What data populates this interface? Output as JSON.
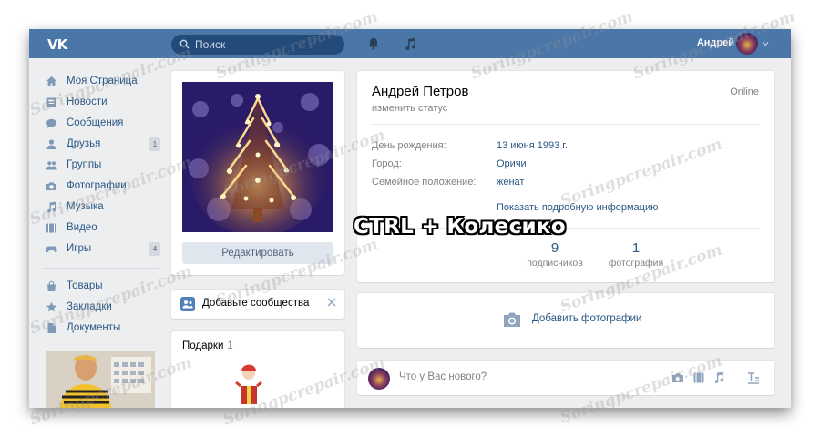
{
  "header": {
    "search_placeholder": "Поиск",
    "user_name": "Андрей",
    "logo_icon": "vk-logo-icon"
  },
  "sidebar": {
    "items": [
      {
        "label": "Моя Страница",
        "icon": "home-icon"
      },
      {
        "label": "Новости",
        "icon": "news-icon"
      },
      {
        "label": "Сообщения",
        "icon": "messages-icon"
      },
      {
        "label": "Друзья",
        "icon": "friends-icon",
        "badge": "1"
      },
      {
        "label": "Группы",
        "icon": "groups-icon"
      },
      {
        "label": "Фотографии",
        "icon": "camera-icon"
      },
      {
        "label": "Музыка",
        "icon": "music-icon"
      },
      {
        "label": "Видео",
        "icon": "video-icon"
      },
      {
        "label": "Игры",
        "icon": "games-icon",
        "badge": "4"
      }
    ],
    "items2": [
      {
        "label": "Товары",
        "icon": "shop-icon"
      },
      {
        "label": "Закладки",
        "icon": "star-icon"
      },
      {
        "label": "Документы",
        "icon": "document-icon"
      }
    ]
  },
  "profile_photo": {
    "edit_label": "Редактировать"
  },
  "communities": {
    "label": "Добавьте сообщества"
  },
  "gifts": {
    "title": "Подарки",
    "count": "1"
  },
  "profile": {
    "name": "Андрей Петров",
    "status": "изменить статус",
    "online": "Online",
    "info": [
      {
        "label": "День рождения:",
        "value": "13 июня 1993 г."
      },
      {
        "label": "Город:",
        "value": "Оричи"
      },
      {
        "label": "Семейное положение:",
        "value": "женат"
      }
    ],
    "more_info": "Показать подробную информацию",
    "counters": [
      {
        "num": "9",
        "label": "подписчиков"
      },
      {
        "num": "1",
        "label": "фотография"
      }
    ]
  },
  "add_photo": {
    "label": "Добавить фотографии"
  },
  "post": {
    "placeholder": "Что у Вас нового?"
  },
  "overlay": {
    "caption": "CTRL + Колесико"
  },
  "watermark": "Soringpcrepair.com",
  "colors": {
    "header": "#4a76a8",
    "link": "#2a5885",
    "background": "#edeef0"
  }
}
